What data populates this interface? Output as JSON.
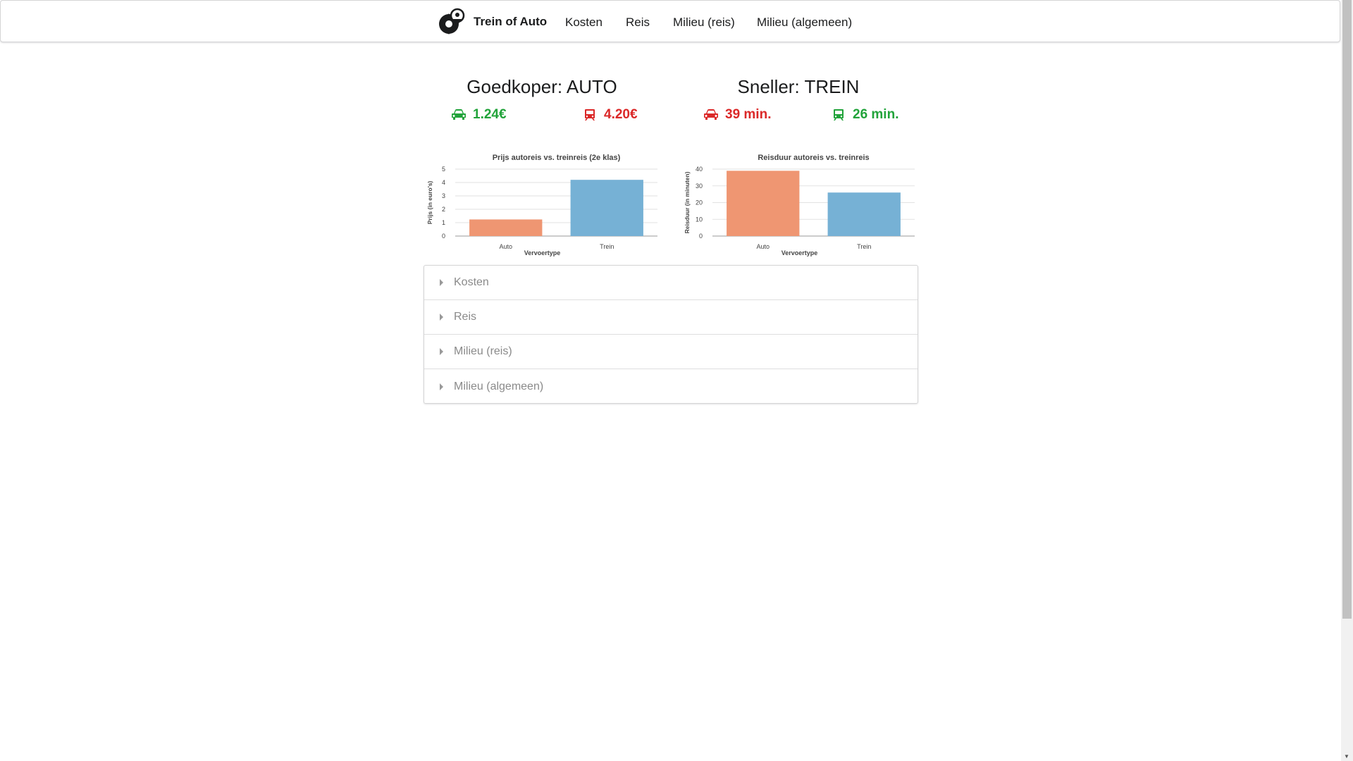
{
  "navbar": {
    "brand": "Trein of Auto",
    "items": [
      "Kosten",
      "Reis",
      "Milieu (reis)",
      "Milieu (algemeen)"
    ]
  },
  "summary": {
    "cheaper": {
      "title": "Goedkoper: AUTO",
      "car_value": "1.24€",
      "train_value": "4.20€"
    },
    "faster": {
      "title": "Sneller: TREIN",
      "car_value": "39 min.",
      "train_value": "26 min."
    }
  },
  "colors": {
    "good": "#21a33a",
    "bad": "#db2828",
    "car_bar": "#ef9672",
    "train_bar": "#76b1d5"
  },
  "icons": {
    "car": "car-icon",
    "train": "train-icon",
    "logo": "settings-location-icon"
  },
  "chart_data": [
    {
      "type": "bar",
      "title": "Prijs autoreis vs. treinreis (2e klas)",
      "xlabel": "Vervoertype",
      "ylabel": "Prijs (in euro's)",
      "categories": [
        "Auto",
        "Trein"
      ],
      "values": [
        1.24,
        4.2
      ],
      "ylim": [
        0,
        5
      ],
      "yticks": [
        0,
        1,
        2,
        3,
        4,
        5
      ],
      "grid": true
    },
    {
      "type": "bar",
      "title": "Reisduur autoreis vs. treinreis",
      "xlabel": "Vervoertype",
      "ylabel": "Reisduur (in minuten)",
      "categories": [
        "Auto",
        "Trein"
      ],
      "values": [
        39,
        26
      ],
      "ylim": [
        0,
        40
      ],
      "yticks": [
        0,
        10,
        20,
        30,
        40
      ],
      "grid": true
    }
  ],
  "accordion": [
    {
      "label": "Kosten"
    },
    {
      "label": "Reis"
    },
    {
      "label": "Milieu (reis)"
    },
    {
      "label": "Milieu (algemeen)"
    }
  ]
}
